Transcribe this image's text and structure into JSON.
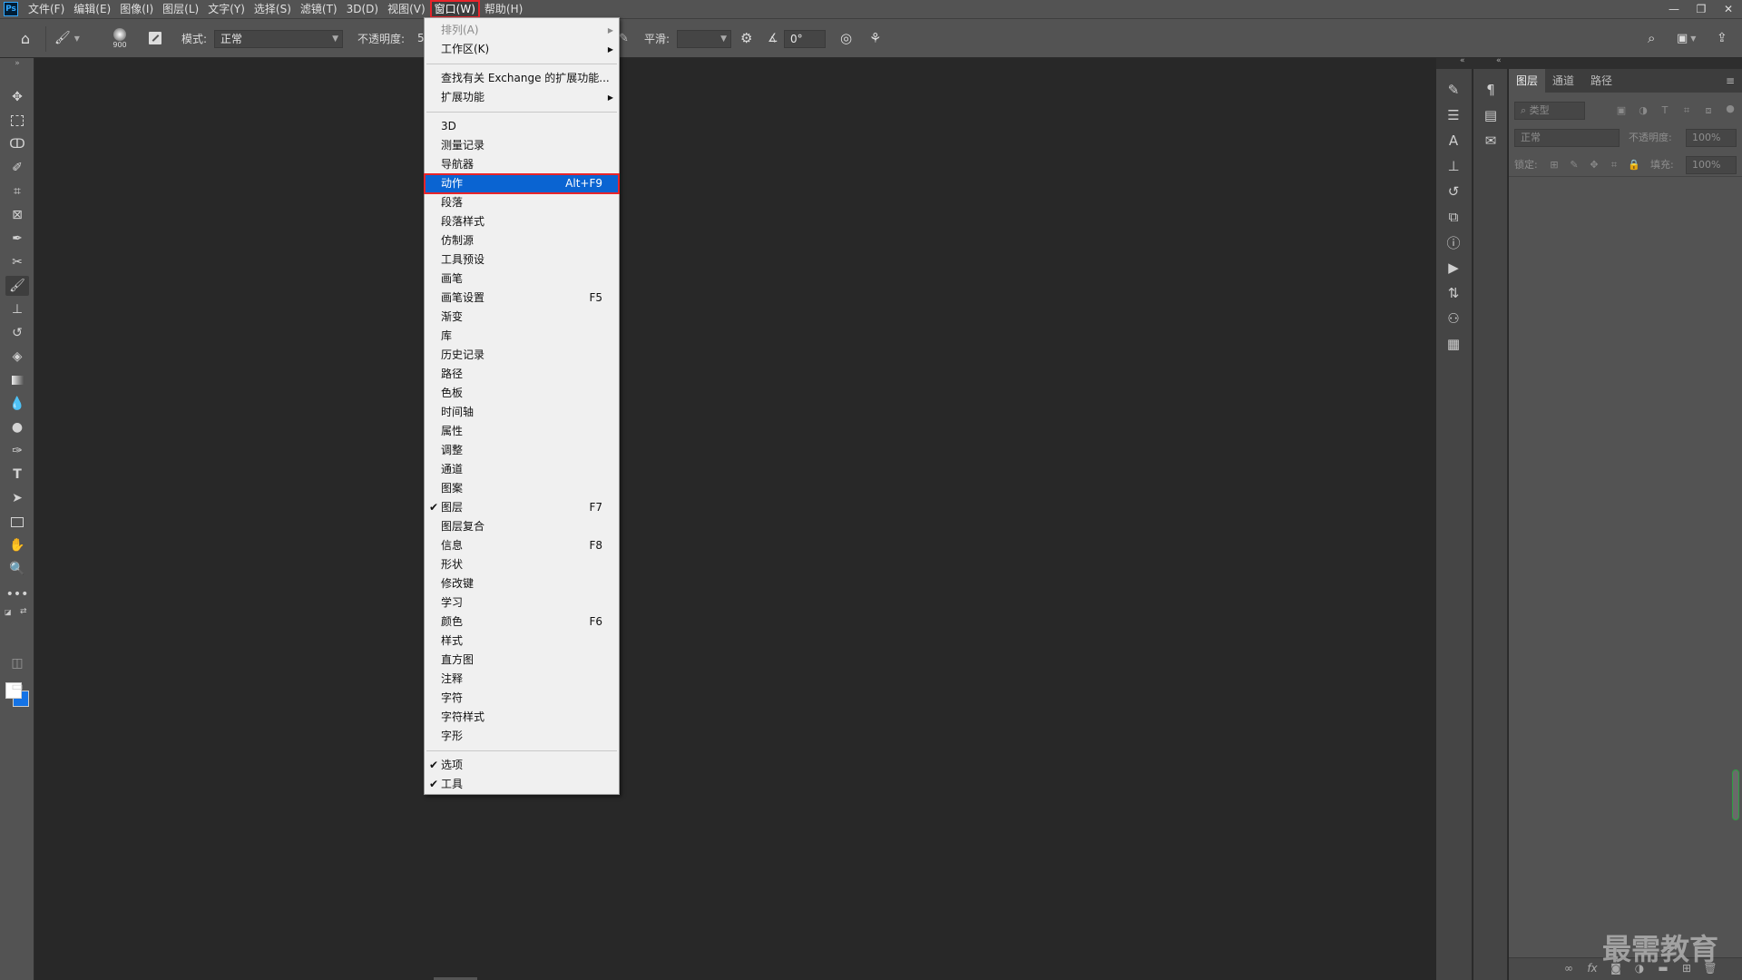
{
  "app": {
    "logo": "Ps"
  },
  "menubar": {
    "items": [
      "文件(F)",
      "编辑(E)",
      "图像(I)",
      "图层(L)",
      "文字(Y)",
      "选择(S)",
      "滤镜(T)",
      "3D(D)",
      "视图(V)",
      "窗口(W)",
      "帮助(H)"
    ],
    "active_index": 9
  },
  "window_controls": {
    "minimize": "—",
    "restore": "❐",
    "close": "✕"
  },
  "options": {
    "brush_size": "900",
    "mode_label": "模式:",
    "mode_value": "正常",
    "opacity_label": "不透明度:",
    "opacity_value": "5",
    "smoothing_label": "平滑:",
    "smoothing_value": "",
    "angle_value": "0°"
  },
  "window_menu": {
    "items": [
      {
        "label": "排列(A)",
        "shortcut": "",
        "submenu": true,
        "checked": false,
        "disabled": true,
        "highlighted": false
      },
      {
        "label": "工作区(K)",
        "shortcut": "",
        "submenu": true,
        "checked": false,
        "disabled": false,
        "highlighted": false
      },
      {
        "sep": true
      },
      {
        "label": "查找有关 Exchange 的扩展功能...",
        "shortcut": "",
        "submenu": false,
        "checked": false,
        "disabled": false,
        "highlighted": false
      },
      {
        "label": "扩展功能",
        "shortcut": "",
        "submenu": true,
        "checked": false,
        "disabled": false,
        "highlighted": false
      },
      {
        "sep": true
      },
      {
        "label": "3D",
        "shortcut": "",
        "submenu": false,
        "checked": false,
        "disabled": false,
        "highlighted": false
      },
      {
        "label": "测量记录",
        "shortcut": "",
        "submenu": false,
        "checked": false,
        "disabled": false,
        "highlighted": false
      },
      {
        "label": "导航器",
        "shortcut": "",
        "submenu": false,
        "checked": false,
        "disabled": false,
        "highlighted": false
      },
      {
        "label": "动作",
        "shortcut": "Alt+F9",
        "submenu": false,
        "checked": false,
        "disabled": false,
        "highlighted": true
      },
      {
        "label": "段落",
        "shortcut": "",
        "submenu": false,
        "checked": false,
        "disabled": false,
        "highlighted": false
      },
      {
        "label": "段落样式",
        "shortcut": "",
        "submenu": false,
        "checked": false,
        "disabled": false,
        "highlighted": false
      },
      {
        "label": "仿制源",
        "shortcut": "",
        "submenu": false,
        "checked": false,
        "disabled": false,
        "highlighted": false
      },
      {
        "label": "工具预设",
        "shortcut": "",
        "submenu": false,
        "checked": false,
        "disabled": false,
        "highlighted": false
      },
      {
        "label": "画笔",
        "shortcut": "",
        "submenu": false,
        "checked": false,
        "disabled": false,
        "highlighted": false
      },
      {
        "label": "画笔设置",
        "shortcut": "F5",
        "submenu": false,
        "checked": false,
        "disabled": false,
        "highlighted": false
      },
      {
        "label": "渐变",
        "shortcut": "",
        "submenu": false,
        "checked": false,
        "disabled": false,
        "highlighted": false
      },
      {
        "label": "库",
        "shortcut": "",
        "submenu": false,
        "checked": false,
        "disabled": false,
        "highlighted": false
      },
      {
        "label": "历史记录",
        "shortcut": "",
        "submenu": false,
        "checked": false,
        "disabled": false,
        "highlighted": false
      },
      {
        "label": "路径",
        "shortcut": "",
        "submenu": false,
        "checked": false,
        "disabled": false,
        "highlighted": false
      },
      {
        "label": "色板",
        "shortcut": "",
        "submenu": false,
        "checked": false,
        "disabled": false,
        "highlighted": false
      },
      {
        "label": "时间轴",
        "shortcut": "",
        "submenu": false,
        "checked": false,
        "disabled": false,
        "highlighted": false
      },
      {
        "label": "属性",
        "shortcut": "",
        "submenu": false,
        "checked": false,
        "disabled": false,
        "highlighted": false
      },
      {
        "label": "调整",
        "shortcut": "",
        "submenu": false,
        "checked": false,
        "disabled": false,
        "highlighted": false
      },
      {
        "label": "通道",
        "shortcut": "",
        "submenu": false,
        "checked": false,
        "disabled": false,
        "highlighted": false
      },
      {
        "label": "图案",
        "shortcut": "",
        "submenu": false,
        "checked": false,
        "disabled": false,
        "highlighted": false
      },
      {
        "label": "图层",
        "shortcut": "F7",
        "submenu": false,
        "checked": true,
        "disabled": false,
        "highlighted": false
      },
      {
        "label": "图层复合",
        "shortcut": "",
        "submenu": false,
        "checked": false,
        "disabled": false,
        "highlighted": false
      },
      {
        "label": "信息",
        "shortcut": "F8",
        "submenu": false,
        "checked": false,
        "disabled": false,
        "highlighted": false
      },
      {
        "label": "形状",
        "shortcut": "",
        "submenu": false,
        "checked": false,
        "disabled": false,
        "highlighted": false
      },
      {
        "label": "修改键",
        "shortcut": "",
        "submenu": false,
        "checked": false,
        "disabled": false,
        "highlighted": false
      },
      {
        "label": "学习",
        "shortcut": "",
        "submenu": false,
        "checked": false,
        "disabled": false,
        "highlighted": false
      },
      {
        "label": "颜色",
        "shortcut": "F6",
        "submenu": false,
        "checked": false,
        "disabled": false,
        "highlighted": false
      },
      {
        "label": "样式",
        "shortcut": "",
        "submenu": false,
        "checked": false,
        "disabled": false,
        "highlighted": false
      },
      {
        "label": "直方图",
        "shortcut": "",
        "submenu": false,
        "checked": false,
        "disabled": false,
        "highlighted": false
      },
      {
        "label": "注释",
        "shortcut": "",
        "submenu": false,
        "checked": false,
        "disabled": false,
        "highlighted": false
      },
      {
        "label": "字符",
        "shortcut": "",
        "submenu": false,
        "checked": false,
        "disabled": false,
        "highlighted": false
      },
      {
        "label": "字符样式",
        "shortcut": "",
        "submenu": false,
        "checked": false,
        "disabled": false,
        "highlighted": false
      },
      {
        "label": "字形",
        "shortcut": "",
        "submenu": false,
        "checked": false,
        "disabled": false,
        "highlighted": false
      },
      {
        "sep": true
      },
      {
        "label": "选项",
        "shortcut": "",
        "submenu": false,
        "checked": true,
        "disabled": false,
        "highlighted": false
      },
      {
        "label": "工具",
        "shortcut": "",
        "submenu": false,
        "checked": true,
        "disabled": false,
        "highlighted": false
      }
    ]
  },
  "toolbar_icons": [
    "move-icon",
    "marquee-icon",
    "lasso-icon",
    "quick-select-icon",
    "crop-icon",
    "frame-icon",
    "eyedropper-icon",
    "healing-icon",
    "brush-icon",
    "stamp-icon",
    "history-brush-icon",
    "eraser-icon",
    "gradient-icon",
    "blur-icon",
    "dodge-icon",
    "pen-icon",
    "type-icon",
    "path-select-icon",
    "rectangle-icon",
    "hand-icon",
    "zoom-icon",
    "more-icon"
  ],
  "layers_panel": {
    "tabs": [
      "图层",
      "通道",
      "路径"
    ],
    "active_tab": 0,
    "filter_placeholder": "类型",
    "blend_mode": "正常",
    "opacity_label": "不透明度:",
    "opacity_value": "100%",
    "lock_label": "锁定:",
    "fill_label": "填充:",
    "fill_value": "100%"
  },
  "watermark": "最需教育",
  "colors": {
    "accent": "#0a64d2",
    "highlight_outline": "#e8242a",
    "foreground": "#ffffff",
    "background": "#1473e6"
  }
}
